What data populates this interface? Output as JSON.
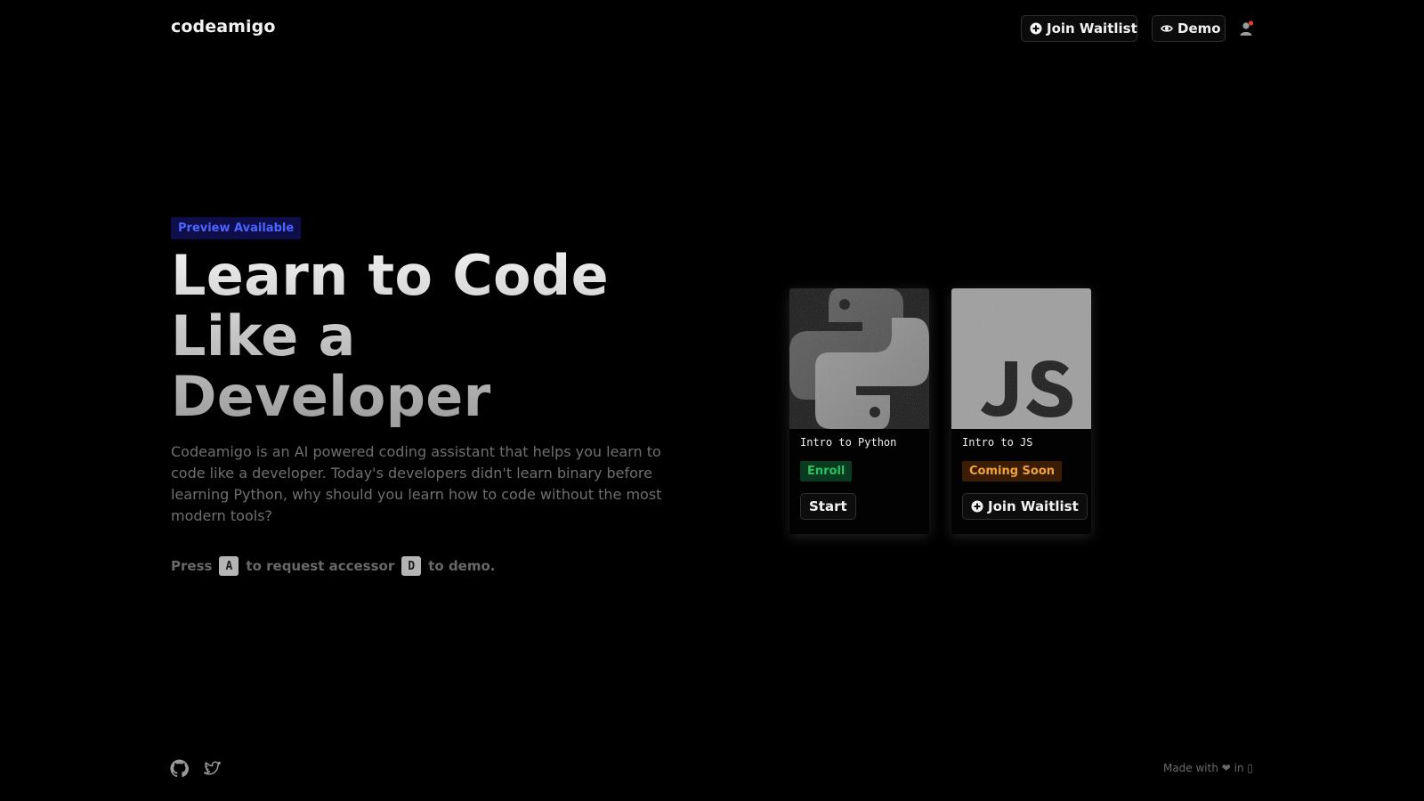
{
  "header": {
    "brand": "codeamigo",
    "join_waitlist_label": "Join Waitlist",
    "demo_label": "Demo",
    "icons": {
      "join_waitlist": "plus-circle-icon",
      "demo": "eye-icon",
      "profile": "user-icon"
    }
  },
  "hero": {
    "badge": "Preview Available",
    "headline": "Learn to Code Like a Developer",
    "description": "Codeamigo is an AI powered coding assistant that helps you learn to code like a developer. Today's developers didn't learn binary before learning Python, why should you learn how to code without the most modern tools?",
    "shortcut": {
      "prefix": "Press",
      "key_access": "A",
      "middle": "to request accessor",
      "key_demo": "D",
      "suffix": "to demo."
    }
  },
  "courses": [
    {
      "title": "Intro to Python",
      "status": "Enroll",
      "button": "Start",
      "image": "python-logo"
    },
    {
      "title": "Intro to JS",
      "status": "Coming Soon",
      "button": "Join Waitlist",
      "image": "javascript-logo"
    }
  ],
  "footer": {
    "made_with": "Made with ❤ in ▯",
    "icons": [
      "github-icon",
      "twitter-icon"
    ]
  },
  "colors": {
    "background": "#000000",
    "badge_bg": "#0e0f4a",
    "badge_text": "#4c63ff",
    "enroll_bg": "#0a3a20",
    "enroll_text": "#27c05c",
    "soon_bg": "#3b1d06",
    "soon_text": "#f0a23a"
  }
}
